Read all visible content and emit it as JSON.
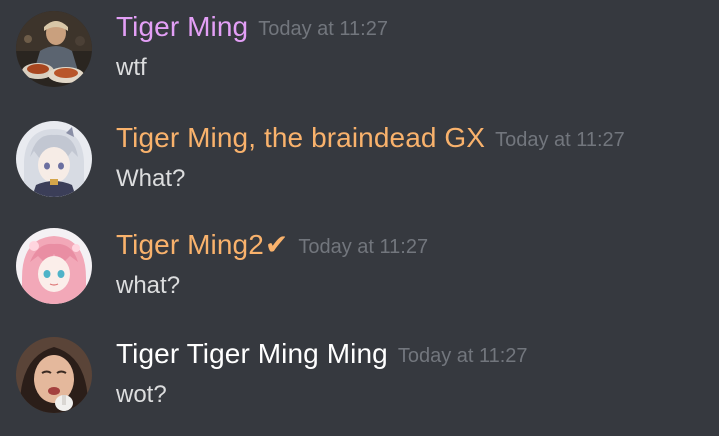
{
  "messages": [
    {
      "author": "Tiger Ming",
      "author_color": "#e39ff6",
      "timestamp": "Today at 11:27",
      "text": "wtf",
      "avatar_icon": "avatar-photo-man-with-food"
    },
    {
      "author": "Tiger Ming, the braindead GX",
      "author_color": "#f9b26c",
      "timestamp": "Today at 11:27",
      "text": "What?",
      "avatar_icon": "avatar-anime-white-hair"
    },
    {
      "author": "Tiger Ming2",
      "author_badge": "✔",
      "author_color": "#f9b26c",
      "timestamp": "Today at 11:27",
      "text": "what?",
      "avatar_icon": "avatar-anime-pink-hair"
    },
    {
      "author": "Tiger Tiger Ming Ming",
      "author_color": "#ffffff",
      "timestamp": "Today at 11:27",
      "text": "wot?",
      "avatar_icon": "avatar-photo-crying-woman"
    }
  ]
}
